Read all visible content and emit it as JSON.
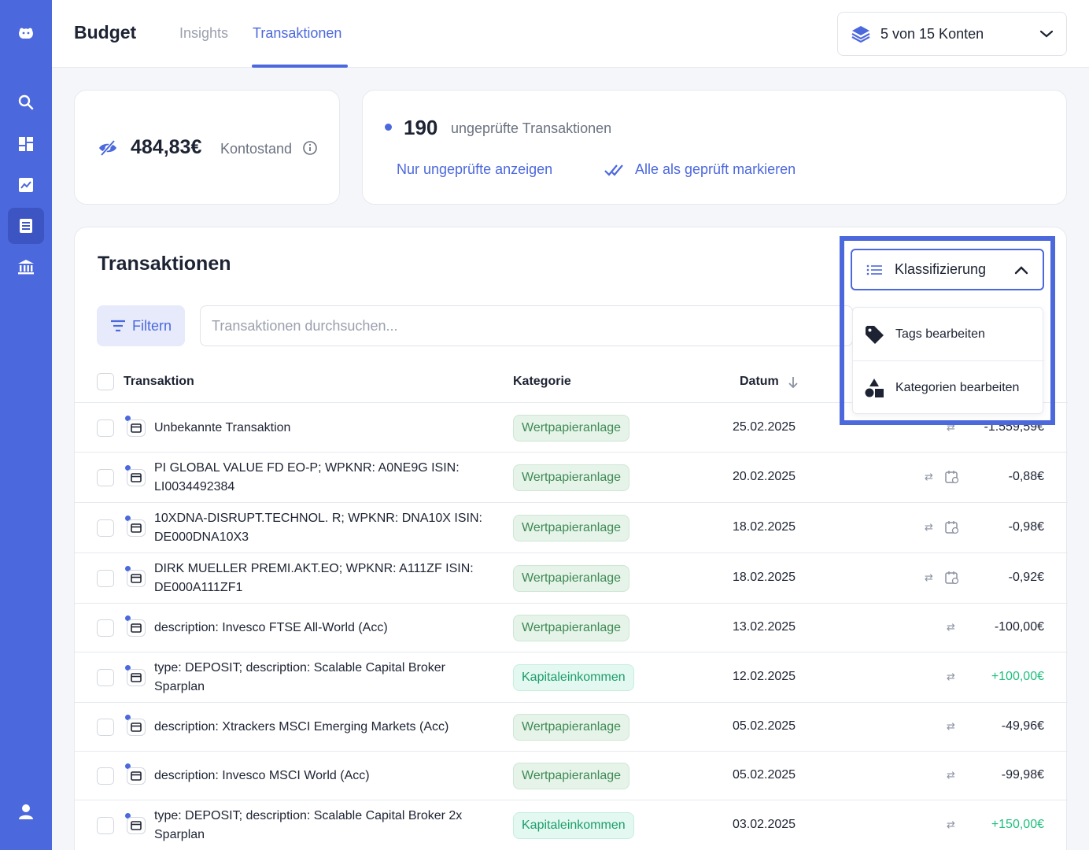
{
  "brand": "Budget",
  "tabs": [
    {
      "label": "Insights",
      "active": false
    },
    {
      "label": "Transaktionen",
      "active": true
    }
  ],
  "account_selector": {
    "label": "5 von 15 Konten",
    "icon": "layers-icon"
  },
  "sidebar": {
    "items": [
      {
        "name": "logo",
        "icon": "hippo-logo-icon"
      },
      {
        "name": "search",
        "icon": "search-icon"
      },
      {
        "name": "dashboard",
        "icon": "dashboard-icon"
      },
      {
        "name": "analytics",
        "icon": "chart-icon"
      },
      {
        "name": "transactions",
        "icon": "list-icon",
        "active": true
      },
      {
        "name": "banks",
        "icon": "bank-icon"
      },
      {
        "name": "profile",
        "icon": "user-icon"
      }
    ]
  },
  "balance": {
    "amount": "484,83€",
    "label": "Kontostand"
  },
  "review": {
    "count": "190",
    "label": "ungeprüfte Transaktionen",
    "show_unreviewed": "Nur ungeprüfte anzeigen",
    "mark_all": "Alle als geprüft markieren"
  },
  "transactions": {
    "title": "Transaktionen",
    "filter_label": "Filtern",
    "search_placeholder": "Transaktionen durchsuchen...",
    "columns": {
      "transaction": "Transaktion",
      "category": "Kategorie",
      "date": "Datum"
    },
    "rows": [
      {
        "name": "Unbekannte Transaktion",
        "category": "Wertpapieranlage",
        "category_type": "wp",
        "date": "25.02.2025",
        "amount": "-1.559,59€",
        "sign": "neg",
        "recurring": false
      },
      {
        "name": "PI GLOBAL VALUE FD EO-P; WPKNR: A0NE9G ISIN: LI0034492384",
        "category": "Wertpapieranlage",
        "category_type": "wp",
        "date": "20.02.2025",
        "amount": "-0,88€",
        "sign": "neg",
        "recurring": true
      },
      {
        "name": "10XDNA-DISRUPT.TECHNOL. R; WPKNR: DNA10X ISIN: DE000DNA10X3",
        "category": "Wertpapieranlage",
        "category_type": "wp",
        "date": "18.02.2025",
        "amount": "-0,98€",
        "sign": "neg",
        "recurring": true
      },
      {
        "name": "DIRK MUELLER PREMI.AKT.EO; WPKNR: A111ZF ISIN: DE000A111ZF1",
        "category": "Wertpapieranlage",
        "category_type": "wp",
        "date": "18.02.2025",
        "amount": "-0,92€",
        "sign": "neg",
        "recurring": true
      },
      {
        "name": "description: Invesco FTSE All-World (Acc)",
        "category": "Wertpapieranlage",
        "category_type": "wp",
        "date": "13.02.2025",
        "amount": "-100,00€",
        "sign": "neg",
        "recurring": false
      },
      {
        "name": "type: DEPOSIT; description: Scalable Capital Broker Sparplan",
        "category": "Kapitaleinkommen",
        "category_type": "ke",
        "date": "12.02.2025",
        "amount": "+100,00€",
        "sign": "pos",
        "recurring": false
      },
      {
        "name": "description: Xtrackers MSCI Emerging Markets (Acc)",
        "category": "Wertpapieranlage",
        "category_type": "wp",
        "date": "05.02.2025",
        "amount": "-49,96€",
        "sign": "neg",
        "recurring": false
      },
      {
        "name": "description: Invesco MSCI World (Acc)",
        "category": "Wertpapieranlage",
        "category_type": "wp",
        "date": "05.02.2025",
        "amount": "-99,98€",
        "sign": "neg",
        "recurring": false
      },
      {
        "name": "type: DEPOSIT; description: Scalable Capital Broker 2x Sparplan",
        "category": "Kapitaleinkommen",
        "category_type": "ke",
        "date": "03.02.2025",
        "amount": "+150,00€",
        "sign": "pos",
        "recurring": false
      }
    ]
  },
  "classification": {
    "button_label": "Klassifizierung",
    "menu": [
      {
        "label": "Tags bearbeiten",
        "icon": "tag-icon"
      },
      {
        "label": "Kategorien bearbeiten",
        "icon": "shapes-icon"
      }
    ]
  },
  "colors": {
    "accent": "#4c68dd",
    "positive": "#1fbe7d",
    "pill_green": "#3f8a54"
  }
}
